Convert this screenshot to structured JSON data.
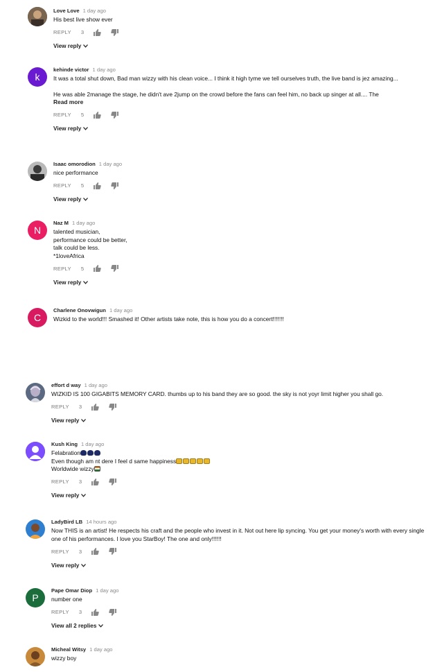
{
  "colors": {
    "avatar_kehinde": "#6a1bd1",
    "avatar_naz": "#e91e63",
    "avatar_charlene": "#d81b60",
    "avatar_pape": "#1b6d3b"
  },
  "icons": [
    "thumbs-up-icon",
    "thumbs-down-icon",
    "chevron-down-icon"
  ],
  "comments": [
    {
      "author": "Love Love",
      "time": "1 day ago",
      "lines": [
        "His best live show ever"
      ],
      "reply": "REPLY",
      "likes": "3",
      "view_replies": "View reply"
    },
    {
      "author": "kehinde victor",
      "time": "1 day ago",
      "avatar_letter": "k",
      "lines": [
        "It was a total shut down, Bad man wizzy with his clean voice... I think it high tyme we tell ourselves truth,  the live band is jez amazing...",
        "He was able 2manage the stage, he didn't ave 2jump on the crowd before the fans can feel him, no back up singer at all.... The"
      ],
      "read_more": "Read more",
      "reply": "REPLY",
      "likes": "5",
      "view_replies": "View reply"
    },
    {
      "author": "Isaac omorodion",
      "time": "1 day ago",
      "lines": [
        "nice performance"
      ],
      "reply": "REPLY",
      "likes": "5",
      "view_replies": "View reply"
    },
    {
      "author": "Naz M",
      "time": "1 day ago",
      "avatar_letter": "N",
      "lines": [
        "talented musician,",
        "performance could be better,",
        "talk could be less.",
        "*1loveAfrica"
      ],
      "reply": "REPLY",
      "likes": "5",
      "view_replies": "View reply"
    },
    {
      "author": "Charlene Onovwigun",
      "time": "1 day ago",
      "avatar_letter": "C",
      "lines": [
        "Wizkid to the world!!! Smashed it! Other artists take note, this is how you do a concert!!!!!!!"
      ]
    },
    {
      "author": "effort d way",
      "time": "1 day ago",
      "lines": [
        "WIZKID IS 100 GIGABITS MEMORY CARD. thumbs up to his band they are so good. the sky is not yoyr limit higher you shall go."
      ],
      "reply": "REPLY",
      "likes": "3",
      "view_replies": "View reply"
    },
    {
      "author": "Kush King",
      "time": "1 day ago",
      "lines": [
        "Felabration",
        "Even though am nt dere I feel d same happiness",
        "Worldwide wizzy"
      ],
      "reply": "REPLY",
      "likes": "3",
      "view_replies": "View reply"
    },
    {
      "author": "LadyBird LB",
      "time": "14 hours ago",
      "lines": [
        "Now THIS is an artist! He respects his craft and the people who invest in it. Not out here lip syncing. You get your money's worth with every single one of his performances. I love you StarBoy! The one and only!!!!!!"
      ],
      "reply": "REPLY",
      "likes": "3",
      "view_replies": "View reply"
    },
    {
      "author": "Pape Omar Diop",
      "time": "1 day ago",
      "avatar_letter": "P",
      "lines": [
        "number one"
      ],
      "reply": "REPLY",
      "likes": "3",
      "view_replies": "View all 2 replies"
    },
    {
      "author": "Micheal Witsy",
      "time": "1 day ago",
      "lines": [
        "wizzy boy"
      ]
    }
  ]
}
